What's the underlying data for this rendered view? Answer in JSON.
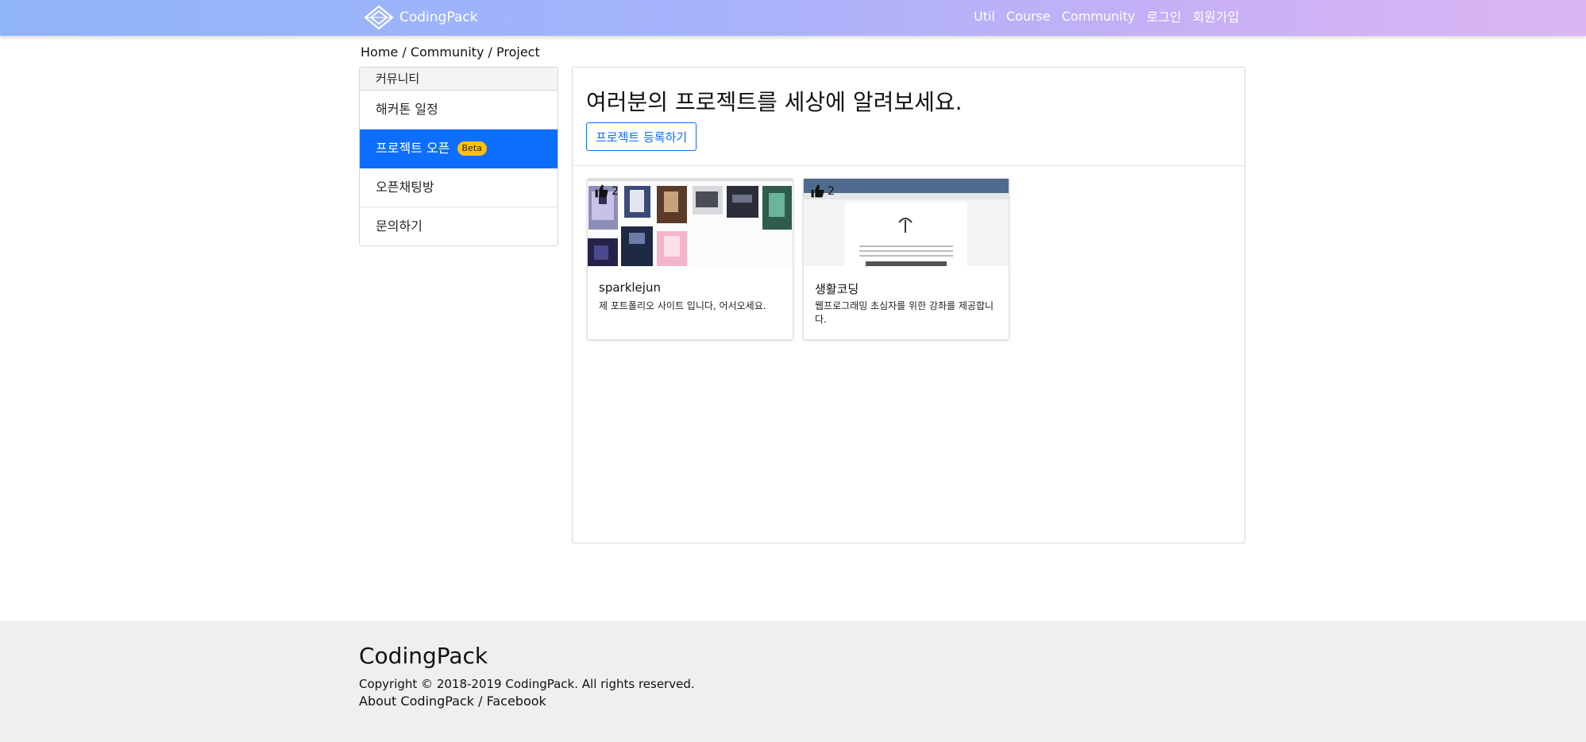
{
  "navbar": {
    "brand": "CodingPack",
    "links": [
      "Util",
      "Course",
      "Community",
      "로그인",
      "회원가입"
    ]
  },
  "breadcrumb": {
    "items": [
      "Home",
      "Community",
      "Project"
    ],
    "separator": " / "
  },
  "sidebar": {
    "header": "커뮤니티",
    "items": [
      {
        "label": "해커톤 일정"
      },
      {
        "label": "프로젝트 오픈",
        "badge": "Beta",
        "active": true
      },
      {
        "label": "오픈채팅방"
      },
      {
        "label": "문의하기"
      }
    ]
  },
  "main": {
    "title": "여러분의 프로젝트를 세상에 알려보세요.",
    "register_button": "프로젝트 등록하기",
    "projects": [
      {
        "title": "sparklejun",
        "description": "제 포트폴리오 사이트 입니다, 어서오세요.",
        "likes": "2",
        "thumbnail": "portfolio-gallery-screenshot",
        "like_icon": "thumbs-up-icon"
      },
      {
        "title": "생활코딩",
        "description": "웹프로그래밍 초심자를 위한 강좌를 제공합니다.",
        "likes": "2",
        "thumbnail": "website-screenshot",
        "like_icon": "thumbs-up-icon"
      }
    ]
  },
  "footer": {
    "brand": "CodingPack",
    "copyright": "Copyright © 2018-2019 CodingPack. All rights reserved.",
    "links": [
      "About CodingPack",
      "Facebook"
    ],
    "link_separator": " / "
  },
  "colors": {
    "primary": "#0d6efd",
    "badge": "#ffc107",
    "navbar_gradient": [
      "#8fb4f7",
      "#a6b3fb",
      "#c7b0f5",
      "#dcb6f4"
    ],
    "footer_bg": "#efefef"
  }
}
